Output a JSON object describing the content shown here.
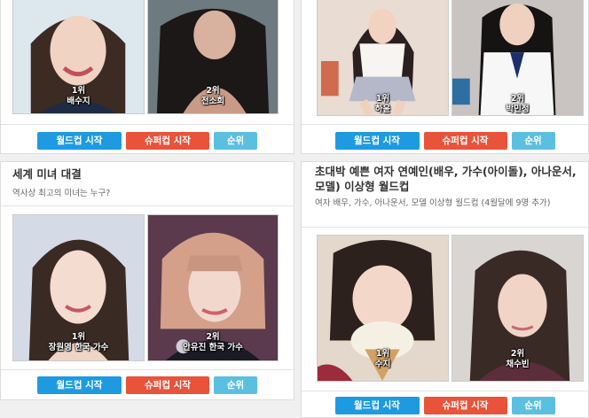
{
  "colors": {
    "worldcup_button": "#1e9be0",
    "superworldcup_button": "#e8533a",
    "ranking_button": "#5bbfe0",
    "page_bg": "#f0f0f0"
  },
  "buttons": {
    "worldcup": "월드컵 시작",
    "superworldcup": "슈퍼컵 시작",
    "ranking": "순위"
  },
  "cards": [
    {
      "title": "",
      "subtitle": "",
      "first": {
        "rank": "1위",
        "name": "배수지"
      },
      "second": {
        "rank": "2위",
        "name": "전소희"
      }
    },
    {
      "title": "",
      "subtitle": "",
      "first": {
        "rank": "1위",
        "name": "하윤"
      },
      "second": {
        "rank": "2위",
        "name": "박민정"
      }
    },
    {
      "title": "세계 미녀 대결",
      "subtitle": "역사상 최고의 미녀는 누구?",
      "first": {
        "rank": "1위",
        "name": "장원영 한국 가수"
      },
      "second": {
        "rank": "2위",
        "name": "안유진 한국 가수"
      }
    },
    {
      "title": "초대박 예쁜 여자 연예인(배우, 가수(아이돌), 아나운서, 모델) 이상형 월드컵",
      "subtitle": "여자 배우, 가수, 아나운서, 모델 이상형 월드컵 (4월달에 9명 추가)",
      "first": {
        "rank": "1위",
        "name": "수지"
      },
      "second": {
        "rank": "2위",
        "name": "채수빈"
      }
    }
  ]
}
